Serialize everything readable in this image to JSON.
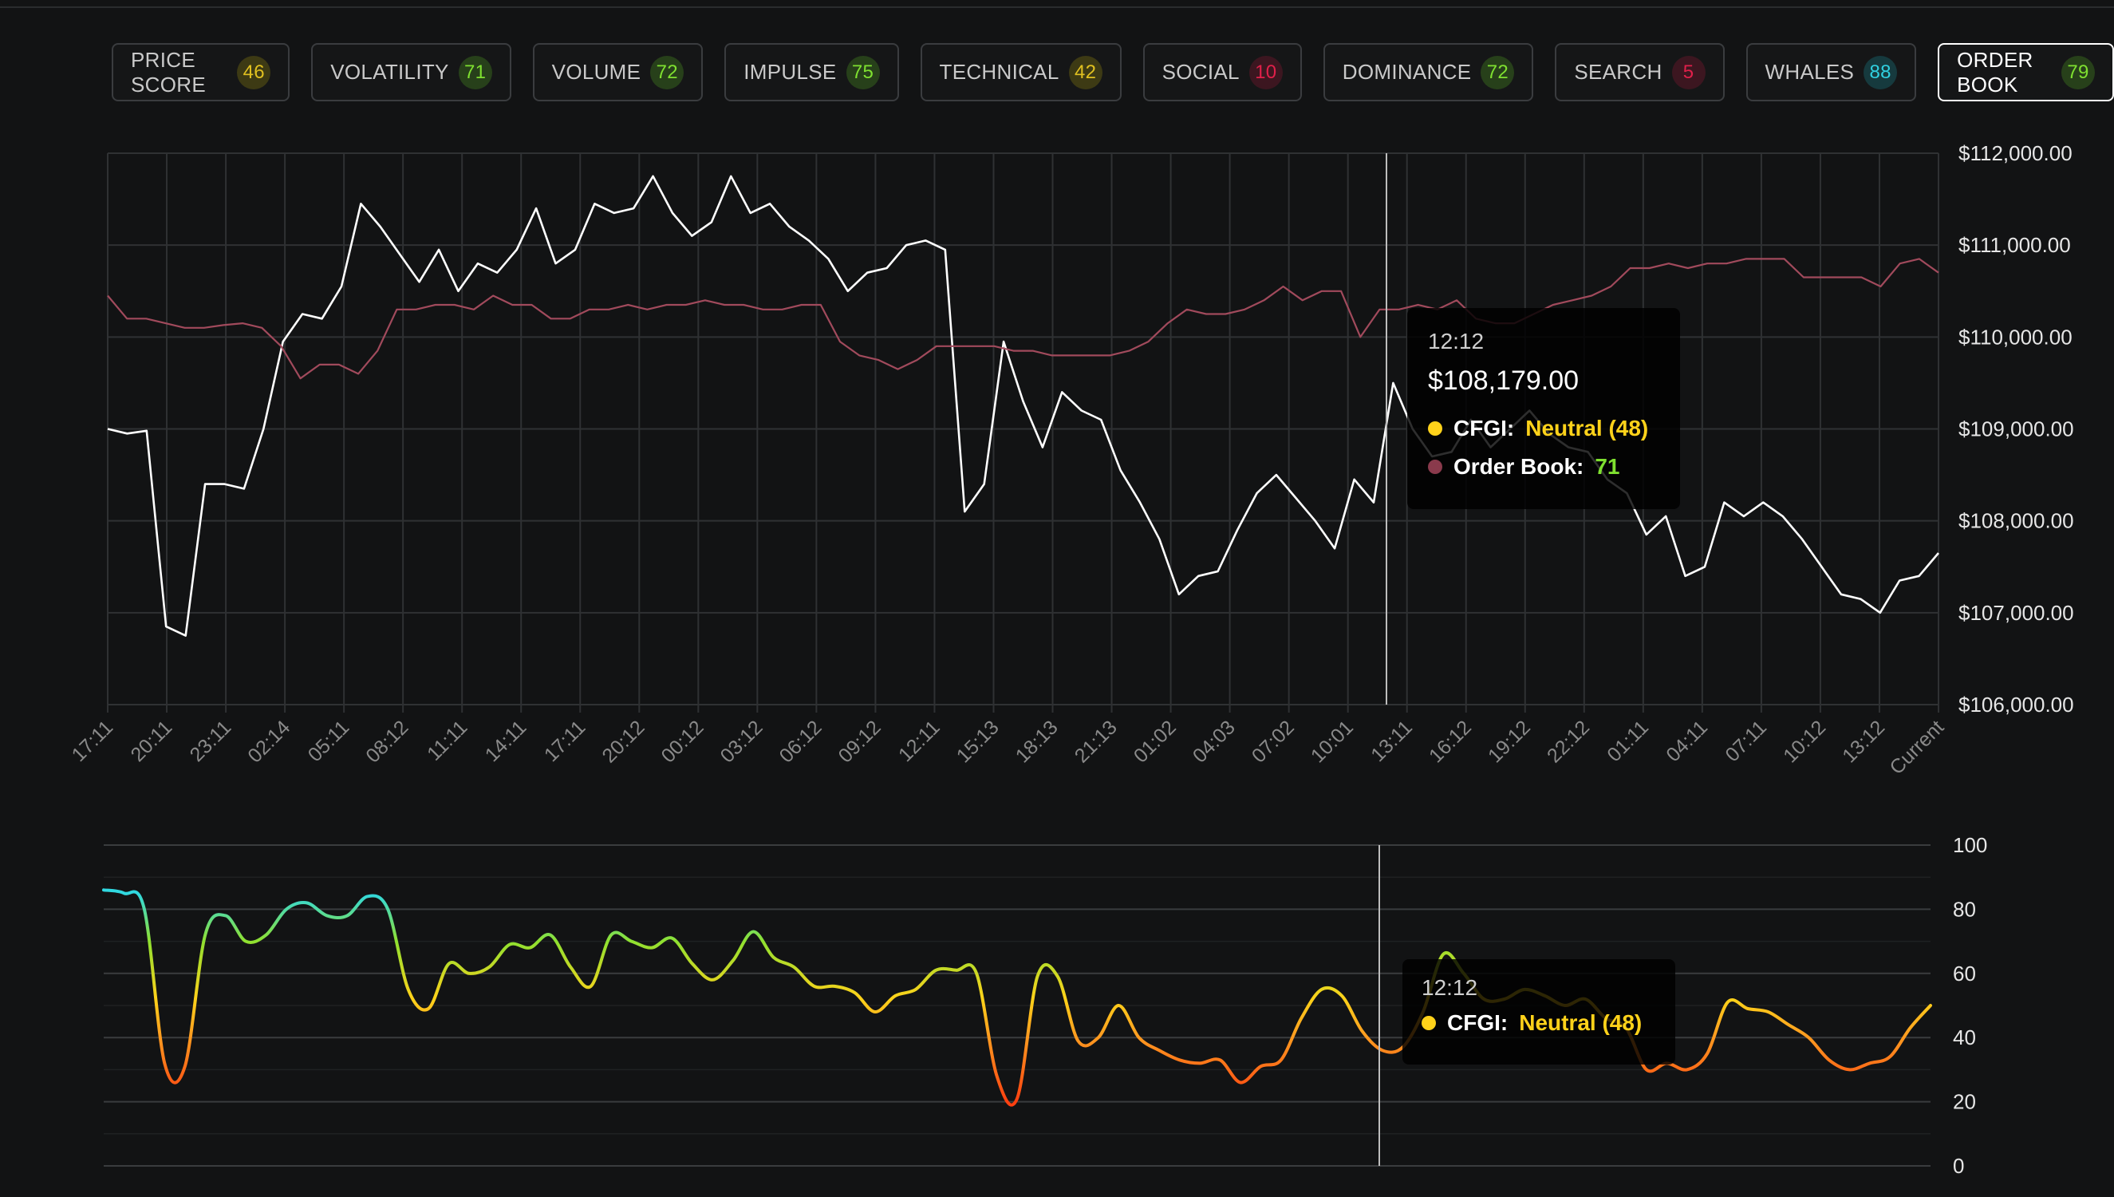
{
  "tabs": [
    {
      "label": "PRICE SCORE",
      "value": "46",
      "color": "#e0c020",
      "bg": "#3d3a14"
    },
    {
      "label": "VOLATILITY",
      "value": "71",
      "color": "#7fe030",
      "bg": "#27401a"
    },
    {
      "label": "VOLUME",
      "value": "72",
      "color": "#7fe030",
      "bg": "#27401a"
    },
    {
      "label": "IMPULSE",
      "value": "75",
      "color": "#7fe030",
      "bg": "#27401a"
    },
    {
      "label": "TECHNICAL",
      "value": "42",
      "color": "#e0c020",
      "bg": "#3d3a14"
    },
    {
      "label": "SOCIAL",
      "value": "10",
      "color": "#e0204a",
      "bg": "#3c1620"
    },
    {
      "label": "DOMINANCE",
      "value": "72",
      "color": "#7fe030",
      "bg": "#27401a"
    },
    {
      "label": "SEARCH",
      "value": "5",
      "color": "#e0204a",
      "bg": "#3c1620"
    },
    {
      "label": "WHALES",
      "value": "88",
      "color": "#30d0e0",
      "bg": "#163a3e"
    },
    {
      "label": "ORDER BOOK",
      "value": "79",
      "color": "#7fe030",
      "bg": "#27401a",
      "active": true
    }
  ],
  "tooltip_top": {
    "time": "12:12",
    "price": "$108,179.00",
    "rows": [
      {
        "label": "CFGI:",
        "value": "Neutral (48)",
        "dot": "#ffd21a",
        "value_color": "#ffd21a"
      },
      {
        "label": "Order Book:",
        "value": "71",
        "dot": "#8a3a4c",
        "value_color": "#7fe030"
      }
    ]
  },
  "tooltip_bottom": {
    "time": "12:12",
    "rows": [
      {
        "label": "CFGI:",
        "value": "Neutral (48)",
        "dot": "#ffd21a",
        "value_color": "#ffd21a"
      }
    ]
  },
  "chart_data": [
    {
      "type": "line",
      "x": [
        "17:11",
        "20:11",
        "23:11",
        "02:14",
        "05:11",
        "08:12",
        "11:11",
        "14:11",
        "17:11",
        "20:12",
        "00:12",
        "03:12",
        "06:12",
        "09:12",
        "12:11",
        "15:13",
        "18:13",
        "21:13",
        "01:02",
        "04:03",
        "07:02",
        "10:01",
        "13:11",
        "16:12",
        "19:12",
        "22:12",
        "01:11",
        "04:11",
        "07:11",
        "10:12",
        "13:12",
        "Current"
      ],
      "ylim": [
        106000,
        112000
      ],
      "yticks": [
        "$106,000.00",
        "$107,000.00",
        "$108,000.00",
        "$109,000.00",
        "$110,000.00",
        "$111,000.00",
        "$112,000.00"
      ],
      "yvalues": [
        106000,
        107000,
        108000,
        109000,
        110000,
        111000,
        112000
      ],
      "grid": true,
      "series": [
        {
          "color": "#ffffff",
          "values": [
            109000,
            108950,
            108980,
            106850,
            106750,
            108400,
            108400,
            108350,
            109000,
            109950,
            110250,
            110200,
            110550,
            111450,
            111200,
            110900,
            110600,
            110950,
            110500,
            110800,
            110700,
            110950,
            111400,
            110800,
            110950,
            111450,
            111350,
            111400,
            111750,
            111350,
            111100,
            111250,
            111750,
            111350,
            111450,
            111200,
            111050,
            110850,
            110500,
            110700,
            110750,
            111000,
            111050,
            110950,
            108100,
            108400,
            109950,
            109300,
            108800,
            109400,
            109200,
            109100,
            108550,
            108200,
            107800,
            107200,
            107400,
            107450,
            107900,
            108300,
            108500,
            108250,
            108000,
            107700,
            108450,
            108200,
            109500,
            109000,
            108700,
            108750,
            109100,
            108800,
            109000,
            109200,
            108950,
            108800,
            108750,
            108450,
            108300,
            107850,
            108050,
            107400,
            107500,
            108200,
            108050,
            108200,
            108050,
            107800,
            107500,
            107200,
            107150,
            107000,
            107350,
            107400,
            107650
          ]
        },
        {
          "color": "#a14a5c",
          "values": [
            110450,
            110200,
            110200,
            110150,
            110100,
            110100,
            110130,
            110150,
            110100,
            109900,
            109550,
            109700,
            109700,
            109600,
            109850,
            110300,
            110300,
            110350,
            110350,
            110300,
            110450,
            110350,
            110350,
            110200,
            110200,
            110300,
            110300,
            110350,
            110300,
            110350,
            110350,
            110400,
            110350,
            110350,
            110300,
            110300,
            110350,
            110350,
            109950,
            109800,
            109750,
            109650,
            109750,
            109900,
            109900,
            109900,
            109900,
            109850,
            109850,
            109800,
            109800,
            109800,
            109800,
            109850,
            109950,
            110150,
            110300,
            110250,
            110250,
            110300,
            110400,
            110550,
            110400,
            110500,
            110500,
            110000,
            110300,
            110300,
            110350,
            110300,
            110400,
            110200,
            110150,
            110150,
            110250,
            110350,
            110400,
            110450,
            110550,
            110750,
            110750,
            110800,
            110750,
            110800,
            110800,
            110850,
            110850,
            110850,
            110650,
            110650,
            110650,
            110650,
            110550,
            110800,
            110850,
            110700
          ]
        }
      ]
    },
    {
      "type": "line",
      "ylim": [
        0,
        100
      ],
      "yticks": [
        "0",
        "20",
        "40",
        "60",
        "80",
        "100"
      ],
      "yvalues": [
        0,
        20,
        40,
        60,
        80,
        100
      ],
      "grid": true,
      "series": [
        {
          "gradient_stops": [
            {
              "v": 20,
              "color": "#ff4010"
            },
            {
              "v": 40,
              "color": "#ff9a20"
            },
            {
              "v": 52,
              "color": "#ffd21a"
            },
            {
              "v": 70,
              "color": "#8fe030"
            },
            {
              "v": 85,
              "color": "#30d8e0"
            }
          ],
          "values": [
            86,
            85,
            80,
            32,
            31,
            72,
            78,
            70,
            72,
            80,
            82,
            78,
            78,
            84,
            80,
            55,
            49,
            63,
            60,
            62,
            69,
            68,
            72,
            62,
            56,
            72,
            70,
            68,
            71,
            63,
            58,
            64,
            73,
            65,
            62,
            56,
            56,
            54,
            48,
            53,
            55,
            61,
            61,
            60,
            28,
            21,
            59,
            59,
            39,
            40,
            50,
            40,
            36,
            33,
            32,
            33,
            26,
            31,
            33,
            46,
            55,
            53,
            42,
            36,
            37,
            48,
            66,
            60,
            52,
            52,
            55,
            53,
            50,
            52,
            46,
            43,
            30,
            32,
            30,
            35,
            51,
            49,
            48,
            44,
            40,
            33,
            30,
            32,
            34,
            43,
            50
          ]
        }
      ]
    }
  ]
}
